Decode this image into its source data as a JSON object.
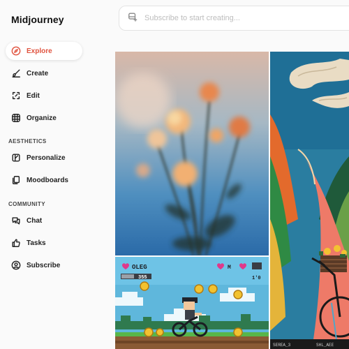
{
  "app": {
    "title": "Midjourney"
  },
  "nav": {
    "explore": "Explore",
    "create": "Create",
    "edit": "Edit",
    "organize": "Organize"
  },
  "aesthetics": {
    "label": "AESTHETICS",
    "personalize": "Personalize",
    "moodboards": "Moodboards"
  },
  "community": {
    "label": "COMMUNITY",
    "chat": "Chat",
    "tasks": "Tasks",
    "subscribe": "Subscribe"
  },
  "search": {
    "placeholder": "Subscribe to start creating..."
  },
  "gallery": {
    "pixel_game": {
      "player_name": "OLEG",
      "score": "355",
      "counter": "1'0",
      "hud_mid": "M"
    },
    "painting": {
      "caption_left": "SEREA_3",
      "caption_right": "SHL_AEE"
    }
  },
  "colors": {
    "accent": "#e0533f",
    "background": "#fafafa"
  }
}
